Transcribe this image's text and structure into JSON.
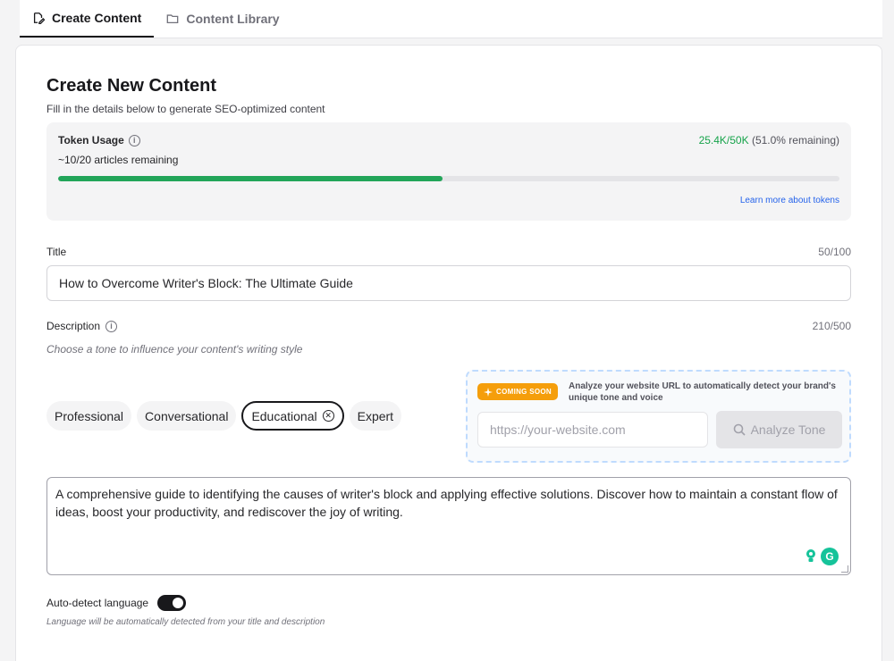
{
  "tabs": [
    {
      "label": "Create Content",
      "icon": "edit-icon",
      "active": true
    },
    {
      "label": "Content Library",
      "icon": "folder-icon",
      "active": false
    }
  ],
  "header": {
    "title": "Create New Content",
    "subtitle": "Fill in the details below to generate SEO-optimized content"
  },
  "tokens": {
    "label": "Token Usage",
    "articles_remaining": "~10/20 articles remaining",
    "used": "25.4K/50K",
    "remaining_pct": "(51.0% remaining)",
    "progress_fraction": 0.492,
    "link": "Learn more about tokens"
  },
  "title_field": {
    "label": "Title",
    "counter": "50/100",
    "value": "How to Overcome Writer's Block: The Ultimate Guide"
  },
  "description_field": {
    "label": "Description",
    "counter": "210/500",
    "tone_hint": "Choose a tone to influence your content's writing style",
    "value": "A comprehensive guide to identifying the causes of writer's block and applying effective solutions. Discover how to maintain a constant flow of ideas, boost your productivity, and rediscover the joy of writing."
  },
  "tones": [
    {
      "label": "Professional",
      "selected": false
    },
    {
      "label": "Conversational",
      "selected": false
    },
    {
      "label": "Educational",
      "selected": true
    },
    {
      "label": "Expert",
      "selected": false
    }
  ],
  "analyze": {
    "badge": "COMING SOON",
    "text": "Analyze your website URL to automatically detect your brand's unique tone and voice",
    "placeholder": "https://your-website.com",
    "button": "Analyze Tone"
  },
  "autodetect": {
    "label": "Auto-detect language",
    "enabled": true,
    "hint": "Language will be automatically detected from your title and description"
  },
  "colors": {
    "accent": "#18181b",
    "progress": "#22a559",
    "link": "#2563eb",
    "badge": "#f59e0b"
  }
}
